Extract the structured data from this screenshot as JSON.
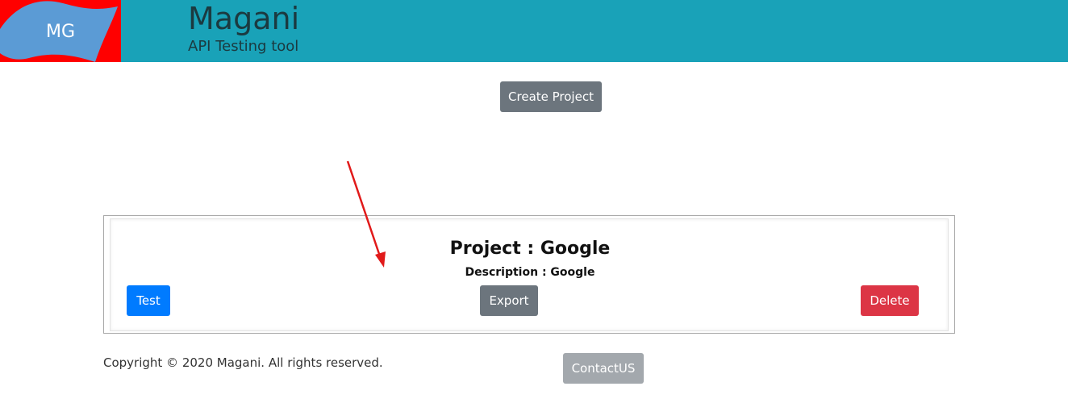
{
  "header": {
    "logo_text": "MG",
    "title": "Magani",
    "subtitle": "API Testing tool",
    "colors": {
      "bar": "#19a2b8",
      "logo_bg": "#ff0000",
      "logo_flag": "#5b9bd5"
    }
  },
  "main": {
    "create_project_label": "Create Project"
  },
  "project_card": {
    "title": "Project : Google",
    "description": "Description : Google",
    "buttons": {
      "test": "Test",
      "export": "Export",
      "delete": "Delete"
    }
  },
  "annotation": {
    "icon": "red-arrow-icon",
    "color": "#e11a1a"
  },
  "footer": {
    "copyright": "Copyright © 2020 Magani. All rights reserved.",
    "contact_label": "ContactUS"
  }
}
